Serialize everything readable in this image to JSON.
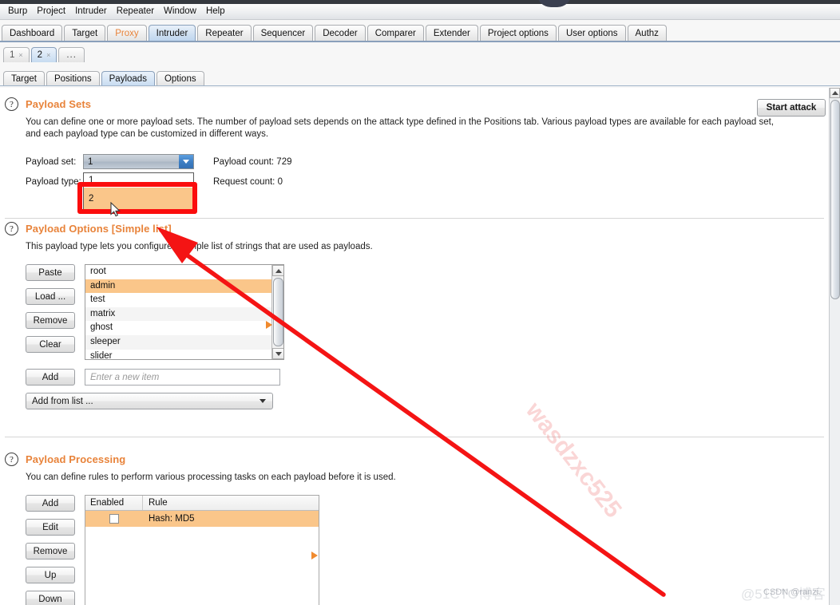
{
  "menubar": {
    "items": [
      "Burp",
      "Project",
      "Intruder",
      "Repeater",
      "Window",
      "Help"
    ]
  },
  "main_tabs": {
    "items": [
      {
        "label": "Dashboard",
        "state": "normal"
      },
      {
        "label": "Target",
        "state": "normal"
      },
      {
        "label": "Proxy",
        "state": "alert"
      },
      {
        "label": "Intruder",
        "state": "selected"
      },
      {
        "label": "Repeater",
        "state": "normal"
      },
      {
        "label": "Sequencer",
        "state": "normal"
      },
      {
        "label": "Decoder",
        "state": "normal"
      },
      {
        "label": "Comparer",
        "state": "normal"
      },
      {
        "label": "Extender",
        "state": "normal"
      },
      {
        "label": "Project options",
        "state": "normal"
      },
      {
        "label": "User options",
        "state": "normal"
      },
      {
        "label": "Authz",
        "state": "normal"
      }
    ]
  },
  "attack_tabs": {
    "items": [
      {
        "label": "1",
        "close": "×",
        "state": "normal"
      },
      {
        "label": "2",
        "close": "×",
        "state": "selected"
      }
    ],
    "more_label": "..."
  },
  "sub_tabs": {
    "items": [
      {
        "label": "Target",
        "state": "normal"
      },
      {
        "label": "Positions",
        "state": "normal"
      },
      {
        "label": "Payloads",
        "state": "selected"
      },
      {
        "label": "Options",
        "state": "normal"
      }
    ]
  },
  "toolbar": {
    "start_attack_label": "Start attack"
  },
  "payload_sets": {
    "help_glyph": "?",
    "title": "Payload Sets",
    "description": "You can define one or more payload sets. The number of payload sets depends on the attack type defined in the Positions tab. Various payload types are available for each payload set, and each payload type can be customized in different ways.",
    "payload_set_label": "Payload set:",
    "payload_set_value": "1",
    "payload_set_options": [
      "1",
      "2"
    ],
    "payload_set_highlighted_option": "2",
    "dropdown_open": true,
    "payload_type_label": "Payload type:",
    "payload_count_label": "Payload count:",
    "payload_count_value": "729",
    "request_count_label": "Request count:",
    "request_count_value": "0"
  },
  "payload_options": {
    "help_glyph": "?",
    "title": "Payload Options [Simple list]",
    "description": "This payload type lets you configure a simple list of strings that are used as payloads.",
    "buttons": [
      "Paste",
      "Load ...",
      "Remove",
      "Clear"
    ],
    "list_items": [
      {
        "value": "root",
        "selected": false
      },
      {
        "value": "admin",
        "selected": true
      },
      {
        "value": "test",
        "selected": false
      },
      {
        "value": "matrix",
        "selected": false
      },
      {
        "value": "ghost",
        "selected": false
      },
      {
        "value": "sleeper",
        "selected": false
      },
      {
        "value": "slider",
        "selected": false
      }
    ],
    "add_button_label": "Add",
    "new_item_placeholder": "Enter a new item",
    "new_item_value": "",
    "add_from_list_label": "Add from list ..."
  },
  "payload_processing": {
    "help_glyph": "?",
    "title": "Payload Processing",
    "description": "You can define rules to perform various processing tasks on each payload before it is used.",
    "buttons": [
      "Add",
      "Edit",
      "Remove",
      "Up",
      "Down"
    ],
    "columns": [
      "Enabled",
      "Rule"
    ],
    "rows": [
      {
        "enabled": false,
        "rule": "Hash: MD5",
        "selected": true
      }
    ]
  },
  "watermarks": {
    "diagonal": "wasdzxc525",
    "cto": "@51CTO博客",
    "csdn": "CSDN @ranzi."
  },
  "colors": {
    "accent_orange": "#e8833a",
    "selection_orange": "#fac68a",
    "annotation_red": "#fb0d0d",
    "tab_selected_blue": "#cfe0f2"
  }
}
